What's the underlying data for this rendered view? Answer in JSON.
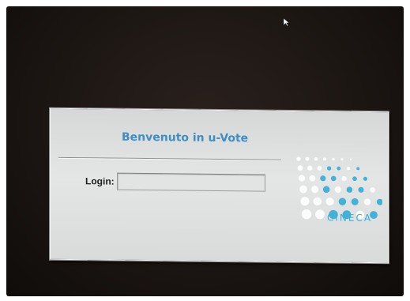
{
  "dialog": {
    "title": "Benvenuto in u-Vote",
    "login_label": "Login:",
    "login_value": "",
    "login_placeholder": ""
  },
  "logo": {
    "text": "CINECA",
    "icon": "cineca-dots-logo"
  },
  "cursor": {
    "icon": "mouse-pointer-icon"
  },
  "colors": {
    "title": "#3e8ec4",
    "logo_blue": "#3aaed8",
    "dialog_bg": "#dfe1e1",
    "screen_bg": "#1c1613"
  }
}
